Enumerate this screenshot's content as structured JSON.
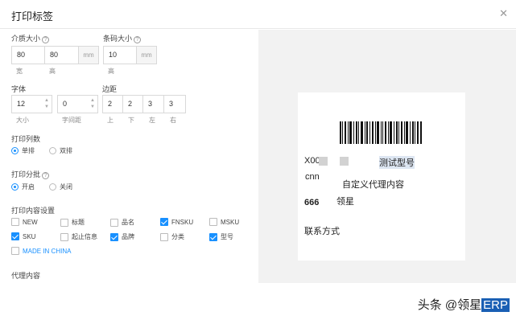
{
  "dialog": {
    "title": "打印标签",
    "close_icon": "close-icon"
  },
  "paper_size": {
    "label": "介质大小",
    "width": "80",
    "height": "80",
    "unit": "mm",
    "width_label": "宽",
    "height_label": "高"
  },
  "barcode_size": {
    "label": "条码大小",
    "height": "10",
    "unit": "mm",
    "height_label": "高"
  },
  "font": {
    "label": "字体",
    "size": "12",
    "spacing": "0",
    "size_label": "大小",
    "spacing_label": "字间距"
  },
  "margin": {
    "label": "边距",
    "top": "2",
    "bottom": "2",
    "left": "3",
    "right": "3",
    "top_label": "上",
    "bottom_label": "下",
    "left_label": "左",
    "right_label": "右"
  },
  "print_columns": {
    "label": "打印列数",
    "options": [
      "单排",
      "双排"
    ],
    "selected": "单排"
  },
  "print_batch": {
    "label": "打印分批",
    "options": [
      "开启",
      "关闭"
    ],
    "selected": "开启"
  },
  "content_settings": {
    "label": "打印内容设置",
    "items": [
      {
        "label": "NEW",
        "checked": false
      },
      {
        "label": "标题",
        "checked": false
      },
      {
        "label": "品名",
        "checked": false
      },
      {
        "label": "FNSKU",
        "checked": true
      },
      {
        "label": "MSKU",
        "checked": false
      },
      {
        "label": "SKU",
        "checked": true
      },
      {
        "label": "起止信息",
        "checked": false
      },
      {
        "label": "品牌",
        "checked": true
      },
      {
        "label": "分类",
        "checked": false
      },
      {
        "label": "型号",
        "checked": true
      },
      {
        "label": "MADE IN CHINA",
        "checked": false
      }
    ]
  },
  "agent_content": {
    "label": "代理内容"
  },
  "preview": {
    "fnsku": "X00",
    "model": "测试型号",
    "sku": "cnn",
    "custom_agent": "自定义代理内容",
    "brand_code": "666",
    "brand": "领星",
    "contact": "联系方式"
  },
  "watermark": {
    "prefix": "头条 @领星",
    "suffix": "ERP"
  },
  "colors": {
    "accent": "#1890ff",
    "preview_bg": "#f2f2f2",
    "highlight": "#dde6f2"
  }
}
